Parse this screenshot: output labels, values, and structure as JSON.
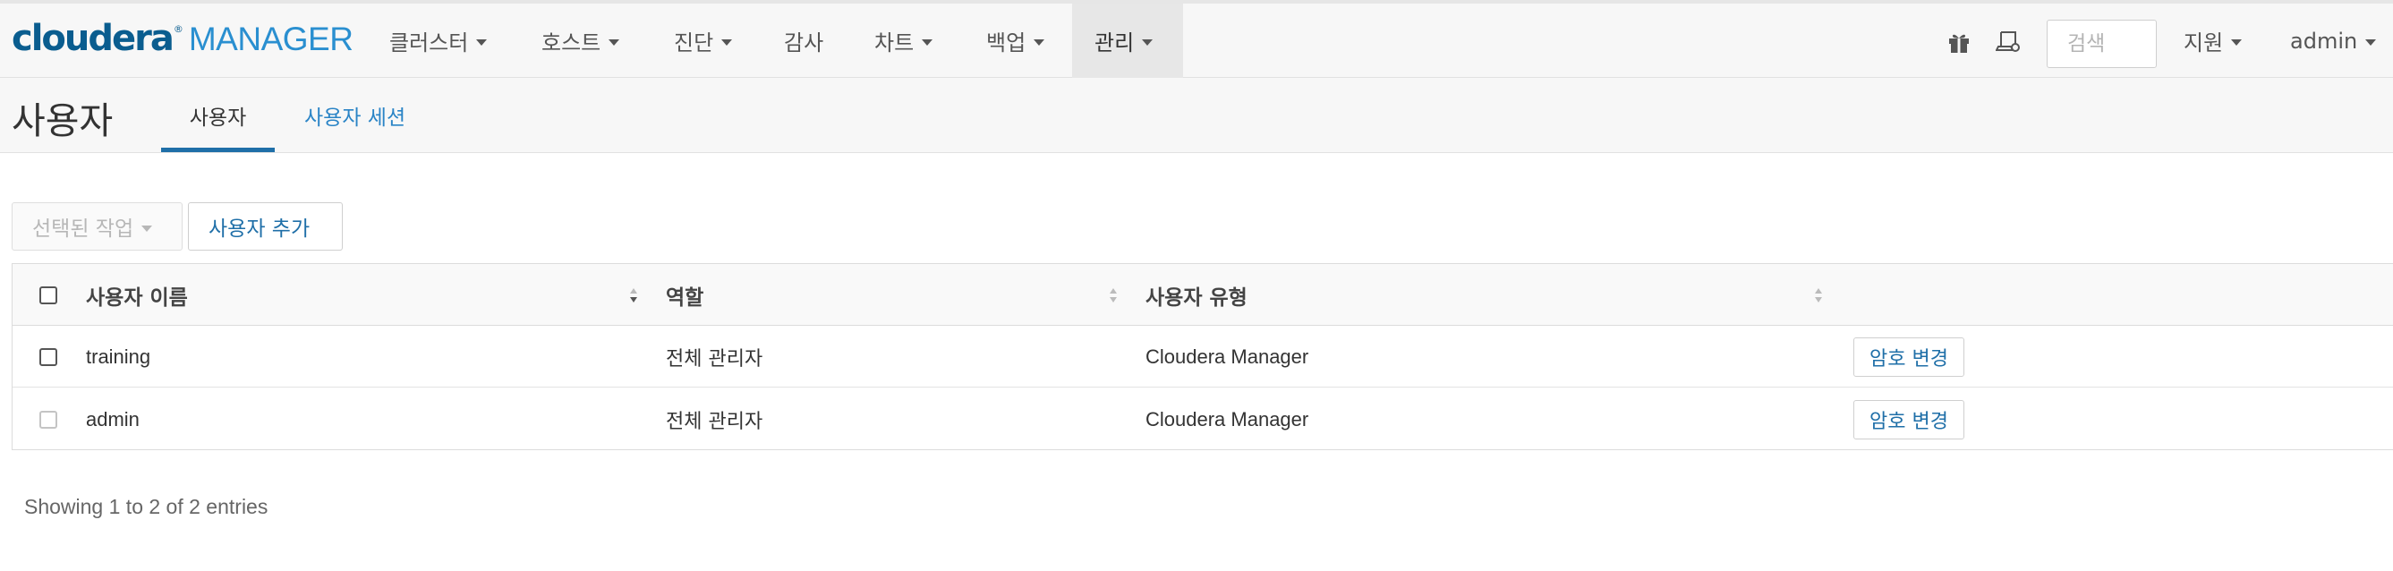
{
  "brand": {
    "name": "cloudera",
    "reg": "®",
    "product": "MANAGER"
  },
  "nav": {
    "items": [
      {
        "label": "클러스터",
        "dropdown": true
      },
      {
        "label": "호스트",
        "dropdown": true
      },
      {
        "label": "진단",
        "dropdown": true
      },
      {
        "label": "감사",
        "dropdown": false
      },
      {
        "label": "차트",
        "dropdown": true
      },
      {
        "label": "백업",
        "dropdown": true
      },
      {
        "label": "관리",
        "dropdown": true,
        "active": true
      }
    ],
    "search_placeholder": "검색",
    "support_label": "지원",
    "user_label": "admin",
    "icons": [
      "gift-icon",
      "laptop-icon"
    ]
  },
  "page": {
    "title": "사용자",
    "tabs": [
      {
        "label": "사용자",
        "active": true
      },
      {
        "label": "사용자 세션",
        "active": false
      }
    ]
  },
  "actions": {
    "selected_actions_label": "선택된 작업",
    "add_user_label": "사용자 추가"
  },
  "table": {
    "columns": [
      "사용자 이름",
      "역할",
      "사용자 유형",
      ""
    ],
    "rows": [
      {
        "name": "training",
        "role": "전체 관리자",
        "type": "Cloudera Manager",
        "action": "암호 변경"
      },
      {
        "name": "admin",
        "role": "전체 관리자",
        "type": "Cloudera Manager",
        "action": "암호 변경"
      }
    ]
  },
  "footer": {
    "info": "Showing 1 to 2 of 2 entries"
  },
  "colors": {
    "brand_dark": "#0a5d8f",
    "brand_light": "#2a8fd0",
    "link": "#2a84c6",
    "active_tab_border": "#1f6fa8"
  }
}
